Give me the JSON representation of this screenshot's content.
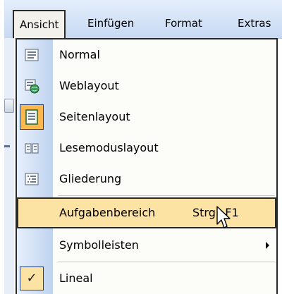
{
  "menubar": {
    "items": [
      {
        "label": "Ansicht",
        "active": true
      },
      {
        "label": "Einfügen",
        "active": false
      },
      {
        "label": "Format",
        "active": false
      },
      {
        "label": "Extras",
        "active": false
      }
    ]
  },
  "menu": {
    "items": [
      {
        "label": "Normal",
        "icon": "normal-view-icon"
      },
      {
        "label": "Weblayout",
        "icon": "web-layout-icon"
      },
      {
        "label": "Seitenlayout",
        "icon": "page-layout-icon",
        "selected": true
      },
      {
        "label": "Lesemoduslayout",
        "icon": "reading-mode-icon"
      },
      {
        "label": "Gliederung",
        "icon": "outline-view-icon"
      },
      {
        "label": "Aufgabenbereich",
        "shortcut": "Strg+F1",
        "highlighted": true
      },
      {
        "label": "Symbolleisten",
        "has_submenu": true
      },
      {
        "label": "Lineal",
        "checked": true,
        "icon": "checkmark-icon"
      }
    ]
  },
  "colors": {
    "highlight": "#fde3a3",
    "selected_icon_bg": "#fdb84d",
    "icon_column": "#c7d9f3",
    "border": "#2a2a2a"
  }
}
